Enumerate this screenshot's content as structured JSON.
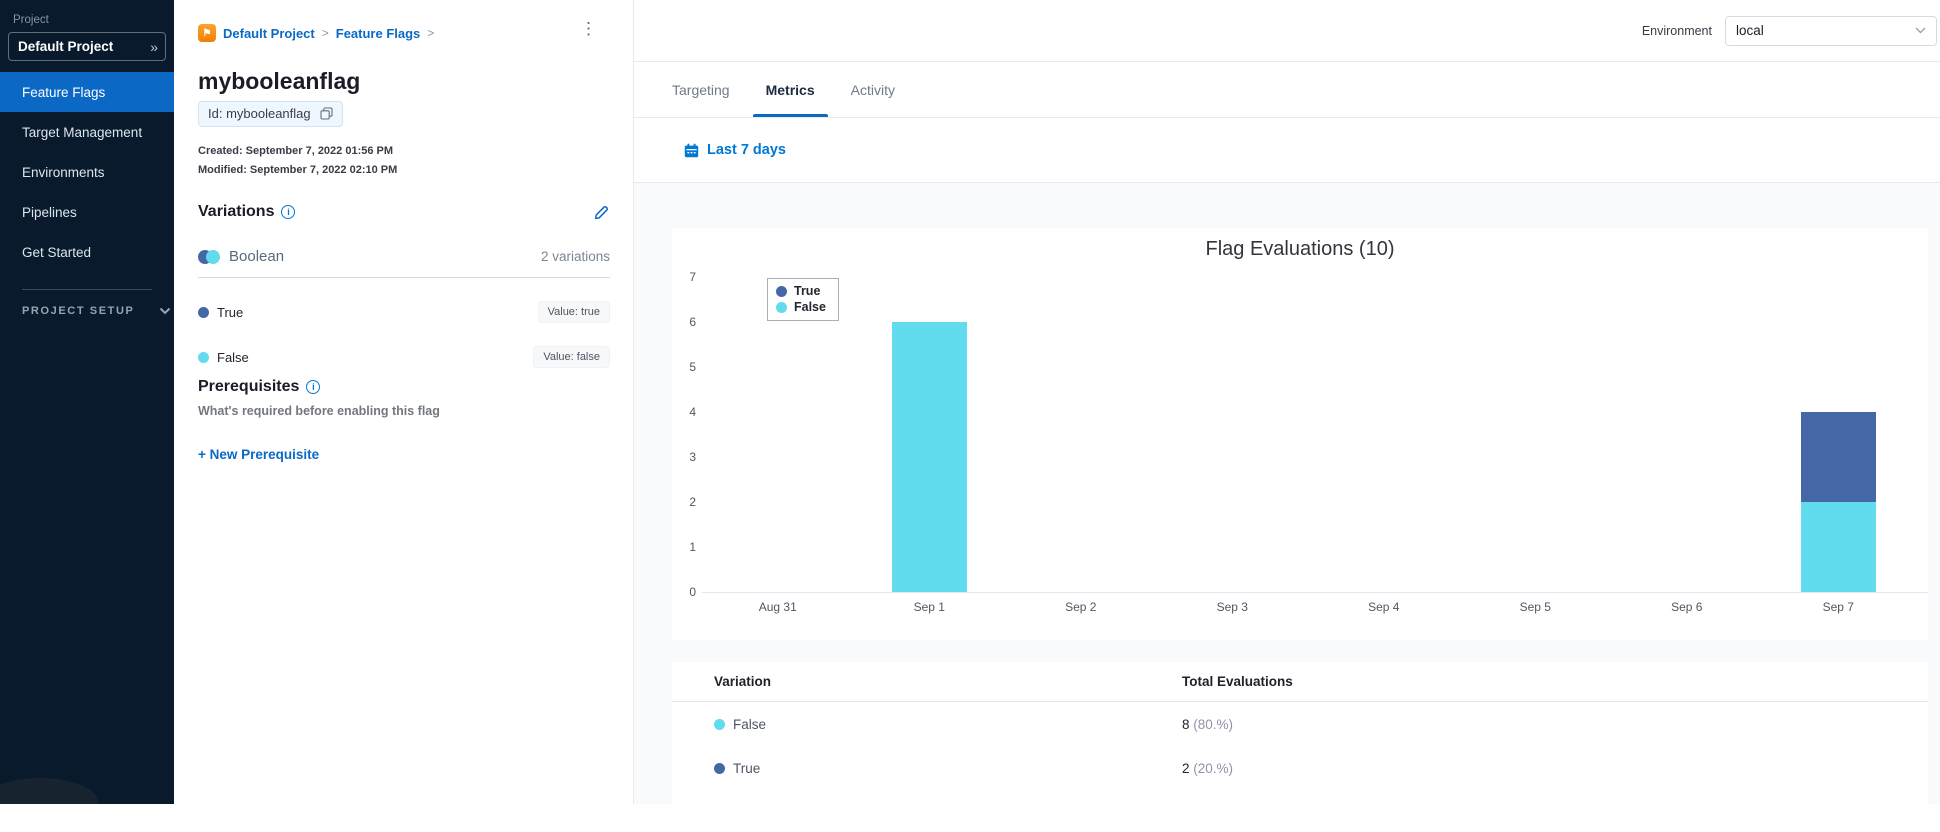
{
  "icons": {
    "kebab": "⋮",
    "flag_logo": "⚑",
    "info": "i"
  },
  "sidebar": {
    "project_label": "Project",
    "project_selector": {
      "value": "Default Project",
      "expand_glyph": "»"
    },
    "items": [
      {
        "label": "Feature Flags",
        "active": true
      },
      {
        "label": "Target Management",
        "active": false
      },
      {
        "label": "Environments",
        "active": false
      },
      {
        "label": "Pipelines",
        "active": false
      },
      {
        "label": "Get Started",
        "active": false
      }
    ],
    "section_toggle": "PROJECT SETUP"
  },
  "flag_detail": {
    "breadcrumb": {
      "project": "Default Project",
      "section": "Feature Flags",
      "sep": ">"
    },
    "title": "mybooleanflag",
    "id_chip": "Id: mybooleanflag",
    "created": "Created: September 7, 2022 01:56 PM",
    "modified": "Modified: September 7, 2022 02:10 PM",
    "variations": {
      "heading": "Variations",
      "type_label": "Boolean",
      "count_label": "2 variations",
      "items": [
        {
          "name": "True",
          "value_label": "Value: true",
          "color": "#4667a6"
        },
        {
          "name": "False",
          "value_label": "Value: false",
          "color": "#61dbee"
        }
      ]
    },
    "prerequisites": {
      "heading": "Prerequisites",
      "description": "What's required before enabling this flag",
      "new_button": "+ New Prerequisite"
    }
  },
  "header": {
    "environment_label": "Environment",
    "environment_value": "local"
  },
  "tabs": [
    {
      "label": "Targeting",
      "active": false
    },
    {
      "label": "Metrics",
      "active": true
    },
    {
      "label": "Activity",
      "active": false
    }
  ],
  "toolbar": {
    "date_range": "Last 7 days"
  },
  "chart_data": {
    "type": "bar",
    "stacked": true,
    "title": "Flag Evaluations (10)",
    "categories": [
      "Aug 31",
      "Sep 1",
      "Sep 2",
      "Sep 3",
      "Sep 4",
      "Sep 5",
      "Sep 6",
      "Sep 7"
    ],
    "series": [
      {
        "name": "True",
        "color": "#4667a6",
        "values": [
          0,
          0,
          0,
          0,
          0,
          0,
          0,
          2
        ]
      },
      {
        "name": "False",
        "color": "#61dbee",
        "values": [
          0,
          6,
          0,
          0,
          0,
          0,
          0,
          2
        ]
      }
    ],
    "ylim": [
      0,
      7
    ],
    "yticks": [
      0,
      1,
      2,
      3,
      4,
      5,
      6,
      7
    ],
    "xlabel": "",
    "ylabel": "",
    "grid": false,
    "legend_position": "top-left-inside",
    "total_evaluations": 10
  },
  "evaluations_table": {
    "columns": [
      "Variation",
      "Total Evaluations"
    ],
    "rows": [
      {
        "variation": "False",
        "color": "#61dbee",
        "count": "8",
        "percent": "(80.%)"
      },
      {
        "variation": "True",
        "color": "#4667a6",
        "count": "2",
        "percent": "(20.%)"
      }
    ]
  },
  "colors": {
    "accent_blue": "#0b69c5",
    "link_blue": "#0278d5",
    "sidebar_bg": "#081a2c",
    "true_blue": "#4667a6",
    "false_cyan": "#61dbee"
  }
}
